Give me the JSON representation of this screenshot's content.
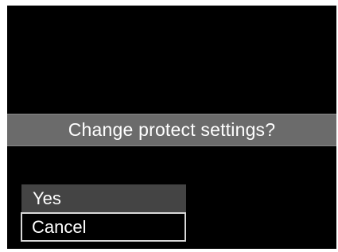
{
  "dialog": {
    "prompt": "Change protect settings?",
    "options": [
      {
        "label": "Yes",
        "selected": false
      },
      {
        "label": "Cancel",
        "selected": true
      }
    ]
  },
  "colors": {
    "screen_bg": "#000000",
    "prompt_bar_bg": "#6b6b6b",
    "option_bg": "#444444",
    "selection_border": "#d8d8d8",
    "text": "#ffffff"
  }
}
